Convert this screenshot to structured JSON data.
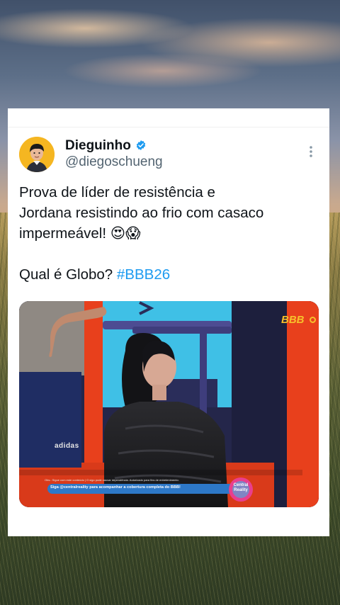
{
  "tweet": {
    "author_name": "Dieguinho",
    "handle": "@diegoschueng",
    "line1": "Prova de líder de resistência e",
    "line2": "Jordana resistindo ao frio com casaco",
    "line3": "impermeável! 😍😱",
    "line4_prefix": "Qual é Globo? ",
    "hashtag": "#BBB26"
  },
  "media": {
    "logo": "BBB",
    "shirt_brand": "adidas",
    "ticker_text": "Siga @centralreality para acompanhar a cobertura completa do BBB!",
    "small_print": "Obs.: Sigue com este conteúdo | O sigo pode causar dependência. Autorizado para fins de entretenimento.",
    "badge_line1": "Central",
    "badge_line2": "Reality"
  },
  "colors": {
    "verified": "#1d9bf0",
    "hashtag": "#1d9bf0",
    "text": "#0f1419",
    "handle": "#536471",
    "set_orange": "#e8401c",
    "set_cyan": "#4fc8e8"
  },
  "icons": [
    "verified-badge-icon",
    "more-options-icon"
  ]
}
